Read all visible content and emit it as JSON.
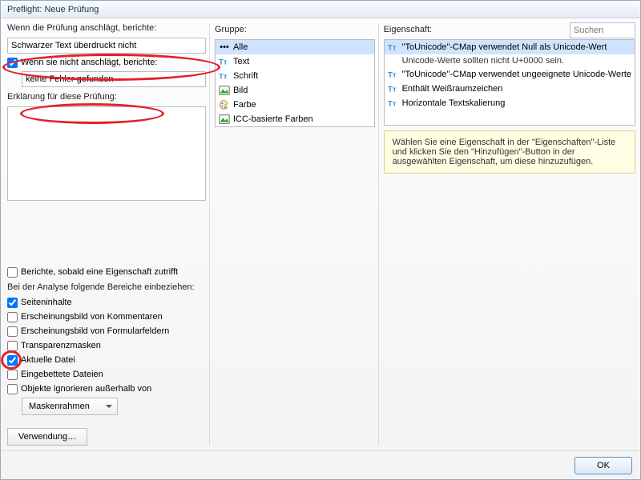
{
  "window": {
    "title": "Preflight: Neue Prüfung"
  },
  "left": {
    "label_when_fires": "Wenn die Prüfung anschlägt, berichte:",
    "input_fires_value": "Schwarzer Text überdruckt nicht",
    "cb_notfires_label": "Wenn sie nicht anschlägt, berichte:",
    "input_notfires_value": "keine Fehler gefunden",
    "label_explain": "Erklärung für diese Prüfung:",
    "cb_report_when_property": "Berichte, sobald eine Eigenschaft zutrifft",
    "label_analysis": "Bei der Analyse folgende Bereiche einbeziehen:",
    "cb_page_content": "Seiteninhalte",
    "cb_comments_appearance": "Erscheinungsbild von Kommentaren",
    "cb_formfields_appearance": "Erscheinungsbild von Formularfeldern",
    "cb_transparency_masks": "Transparenzmasken",
    "cb_current_file": "Aktuelle Datei",
    "cb_embedded_files": "Eingebettete Dateien",
    "cb_ignore_objects": "Objekte ignorieren außerhalb von",
    "dropdown_mask": "Maskenrahmen",
    "btn_usage": "Verwendung…"
  },
  "mid": {
    "label": "Gruppe:",
    "items": [
      "Alle",
      "Text",
      "Schrift",
      "Bild",
      "Farbe",
      "ICC-basierte Farben"
    ]
  },
  "right": {
    "label": "Eigenschaft:",
    "search_placeholder": "Suchen",
    "items": [
      {
        "t": "\"ToUnicode\"-CMap verwendet Null als Unicode-Wert",
        "sel": true
      },
      {
        "t": "Unicode-Werte sollten nicht U+0000 sein.",
        "sub": true
      },
      {
        "t": "\"ToUnicode\"-CMap verwendet ungeeignete Unicode-Werte"
      },
      {
        "t": "Enthält Weißraumzeichen"
      },
      {
        "t": "Horizontale Textskalierung"
      }
    ],
    "hint": "Wählen Sie eine Eigenschaft in der \"Eigenschaften\"-Liste und klicken Sie den \"Hinzufügen\"-Button in der ausgewählten Eigenschaft, um diese hinzuzufügen."
  },
  "footer": {
    "ok": "OK"
  },
  "icons": {
    "dots_color": "#000",
    "tt_color": "#3c8fd6",
    "img_fill": "#1cb21c",
    "palette_fill": "#d06c00",
    "icc_fill": "#2aa22a"
  }
}
